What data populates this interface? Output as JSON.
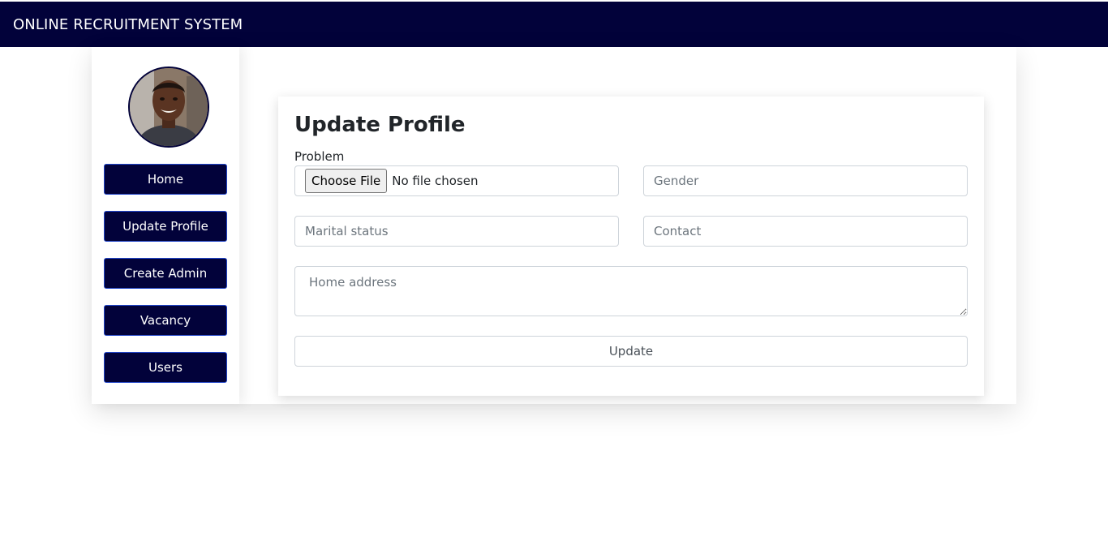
{
  "navbar": {
    "brand": "ONLINE RECRUITMENT SYSTEM"
  },
  "sidebar": {
    "avatar": "user-avatar-photo",
    "items": [
      {
        "label": "Home"
      },
      {
        "label": "Update Profile"
      },
      {
        "label": "Create Admin"
      },
      {
        "label": "Vacancy"
      },
      {
        "label": "Users"
      }
    ]
  },
  "form": {
    "title": "Update Profile",
    "file_label": "Problem",
    "file_button": "Choose File",
    "file_status": "No file chosen",
    "gender_placeholder": "Gender",
    "marital_placeholder": "Marital status",
    "contact_placeholder": "Contact",
    "address_placeholder": "Home address",
    "submit_label": "Update"
  },
  "colors": {
    "navbar": "#02023a",
    "nav_button": "#02023a",
    "nav_button_border": "#2246c9"
  }
}
